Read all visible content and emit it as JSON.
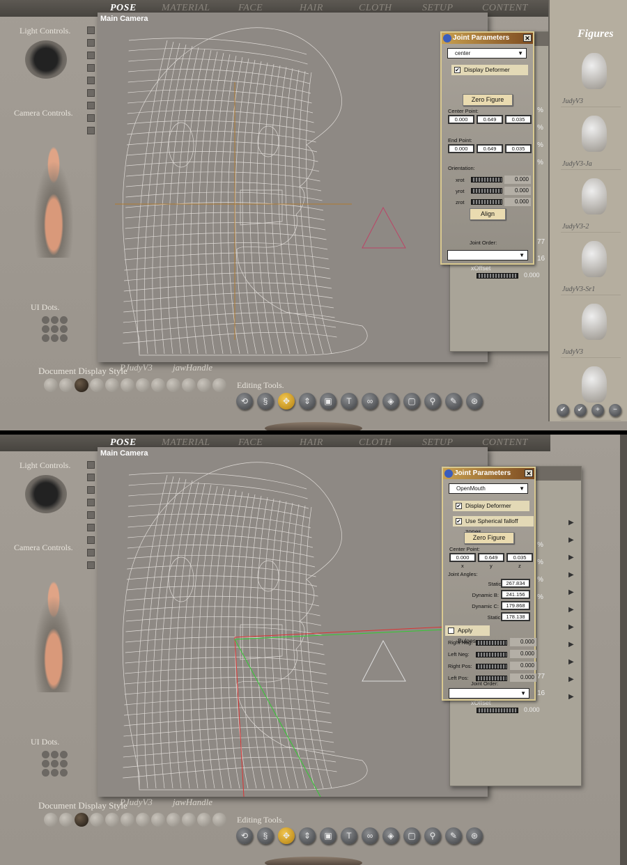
{
  "screens": [
    {
      "tabs": [
        "POSE",
        "MATERIAL",
        "FACE",
        "HAIR",
        "CLOTH",
        "SETUP",
        "CONTENT"
      ],
      "viewport_label": "Main Camera",
      "light_controls": "Light Controls.",
      "camera_controls": "Camera Controls.",
      "ui_dots": "UI Dots.",
      "document_display_style": "Document Display Style",
      "figure_menu": "PJudyV3",
      "actor_menu": "jawHandle",
      "editing_tools": "Editing Tools.",
      "library_title": "Figures",
      "library_items": [
        "JudyV3",
        "JudyV3-Ja",
        "JudyV3-2",
        "JudyV3-Sr1",
        "JudyV3",
        ""
      ],
      "behind_panel": {
        "percent": "%",
        "v1": "77",
        "v2": "16",
        "xoffset_label": "xOffset",
        "xoffset_value": "0.000"
      },
      "joint": {
        "title": "Joint Parameters",
        "close": "✕",
        "selection": "center",
        "display_deformer": "Display Deformer",
        "display_deformer_checked": true,
        "zero_figure": "Zero Figure",
        "center_point_label": "Center Point:",
        "center_point": [
          "0.000",
          "0.649",
          "0.035"
        ],
        "end_point_label": "End Point:",
        "end_point": [
          "0.000",
          "0.649",
          "0.035"
        ],
        "orientation_label": "Orientation:",
        "orientation": [
          {
            "name": "xrot",
            "value": "0.000"
          },
          {
            "name": "yrot",
            "value": "0.000"
          },
          {
            "name": "zrot",
            "value": "0.000"
          }
        ],
        "align": "Align",
        "joint_order_label": "Joint Order:",
        "joint_order": ""
      }
    },
    {
      "tabs": [
        "POSE",
        "MATERIAL",
        "FACE",
        "HAIR",
        "CLOTH",
        "SETUP",
        "CONTENT"
      ],
      "viewport_label": "Main Camera",
      "light_controls": "Light Controls.",
      "camera_controls": "Camera Controls.",
      "ui_dots": "UI Dots.",
      "document_display_style": "Document Display Style",
      "figure_menu": "PJudyV3",
      "actor_menu": "jawHandle",
      "editing_tools": "Editing Tools.",
      "behind_panel": {
        "percent": "%",
        "v1": "77",
        "v2": "16",
        "xoffset_label": "xOffset",
        "xoffset_value": "0.000"
      },
      "joint": {
        "title": "Joint Parameters",
        "close": "✕",
        "selection": "OpenMouth",
        "display_deformer": "Display Deformer",
        "display_deformer_checked": true,
        "spherical": "Use Spherical falloff zones",
        "spherical_checked": true,
        "zero_figure": "Zero Figure",
        "center_point_label": "Center Point:",
        "center_point": [
          "0.000",
          "0.649",
          "0.035"
        ],
        "axes": [
          "x",
          "y",
          "z"
        ],
        "joint_angles_label": "Joint Angles:",
        "angles": [
          {
            "name": "Static A:",
            "value": "267.834"
          },
          {
            "name": "Dynamic B:",
            "value": "241.156"
          },
          {
            "name": "Dynamic C:",
            "value": "179.868"
          },
          {
            "name": "Static D:",
            "value": "178.138"
          }
        ],
        "apply_bulges": "Apply Bulges",
        "apply_bulges_checked": false,
        "bulges": [
          {
            "name": "Right Neg:",
            "value": "0.000"
          },
          {
            "name": "Left Neg:",
            "value": "0.000"
          },
          {
            "name": "Right Pos:",
            "value": "0.000"
          },
          {
            "name": "Left Pos:",
            "value": "0.000"
          }
        ],
        "joint_order_label": "Joint Order:",
        "joint_order": ""
      }
    }
  ],
  "editing_tool_icons": [
    "rotate-icon",
    "twist-icon",
    "translate-icon",
    "translate-in-out-icon",
    "scale-icon",
    "taper-icon",
    "chain-break-icon",
    "color-icon",
    "grouping-icon",
    "view-magnifier-icon",
    "morph-brush-icon",
    "direct-manipulation-icon"
  ],
  "editing_tool_glyphs": [
    "⟲",
    "§",
    "✥",
    "⇕",
    "▣",
    "T",
    "∞",
    "◈",
    "▢",
    "⚲",
    "✎",
    "⊛"
  ],
  "selected_tool_index": 2,
  "colors": {
    "accent": "#e2a92a",
    "viewport": "#8e8984",
    "panel": "#a39d95"
  }
}
